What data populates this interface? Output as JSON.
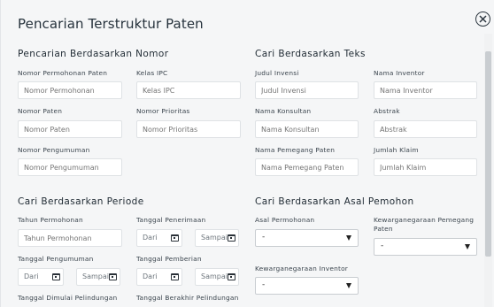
{
  "modal": {
    "title": "Pencarian Terstruktur Paten",
    "close_icon": "close-circle-icon"
  },
  "sections": {
    "nomor": "Pencarian Berdasarkan Nomor",
    "teks": "Cari Berdasarkan Teks",
    "periode": "Cari Berdasarkan Periode",
    "asal": "Cari Berdasarkan Asal Pemohon"
  },
  "nomor": {
    "permohonan": {
      "label": "Nomor Permohonan Paten",
      "placeholder": "Nomor Permohonan"
    },
    "ipc": {
      "label": "Kelas IPC",
      "placeholder": "Kelas IPC"
    },
    "paten": {
      "label": "Nomor Paten",
      "placeholder": "Nomor Paten"
    },
    "prioritas": {
      "label": "Nomor Prioritas",
      "placeholder": "Nomor Prioritas"
    },
    "pengumuman": {
      "label": "Nomor Pengumuman",
      "placeholder": "Nomor Pengumuman"
    }
  },
  "teks": {
    "judul": {
      "label": "Judul Invensi",
      "placeholder": "Judul Invensi"
    },
    "inventor": {
      "label": "Nama Inventor",
      "placeholder": "Nama Inventor"
    },
    "konsultan": {
      "label": "Nama Konsultan",
      "placeholder": "Nama Konsultan"
    },
    "abstrak": {
      "label": "Abstrak",
      "placeholder": "Abstrak"
    },
    "pemegang": {
      "label": "Nama Pemegang Paten",
      "placeholder": "Nama Pemegang Paten"
    },
    "klaim": {
      "label": "Jumlah Klaim",
      "placeholder": "Jumlah Klaim"
    }
  },
  "periode": {
    "tahun": {
      "label": "Tahun Permohonan",
      "placeholder": "Tahun Permohonan"
    },
    "penerimaan": {
      "label": "Tanggal Penerimaan",
      "from": "Dari",
      "to": "Sampai"
    },
    "pengumuman": {
      "label": "Tanggal Pengumuman",
      "from": "Dari",
      "to": "Sampai"
    },
    "pemberian": {
      "label": "Tanggal Pemberian",
      "from": "Dari",
      "to": "Sampai"
    },
    "dimulai": {
      "label": "Tanggal Dimulai Pelindungan"
    },
    "berakhir": {
      "label": "Tanggal Berakhir Pelindungan"
    }
  },
  "asal": {
    "permohonan": {
      "label": "Asal Permohonan",
      "value": "-"
    },
    "pemegang": {
      "label": "Kewarganegaraan Pemegang Paten",
      "value": "-"
    },
    "inventor": {
      "label": "Kewarganegaraan Inventor",
      "value": "-"
    }
  }
}
